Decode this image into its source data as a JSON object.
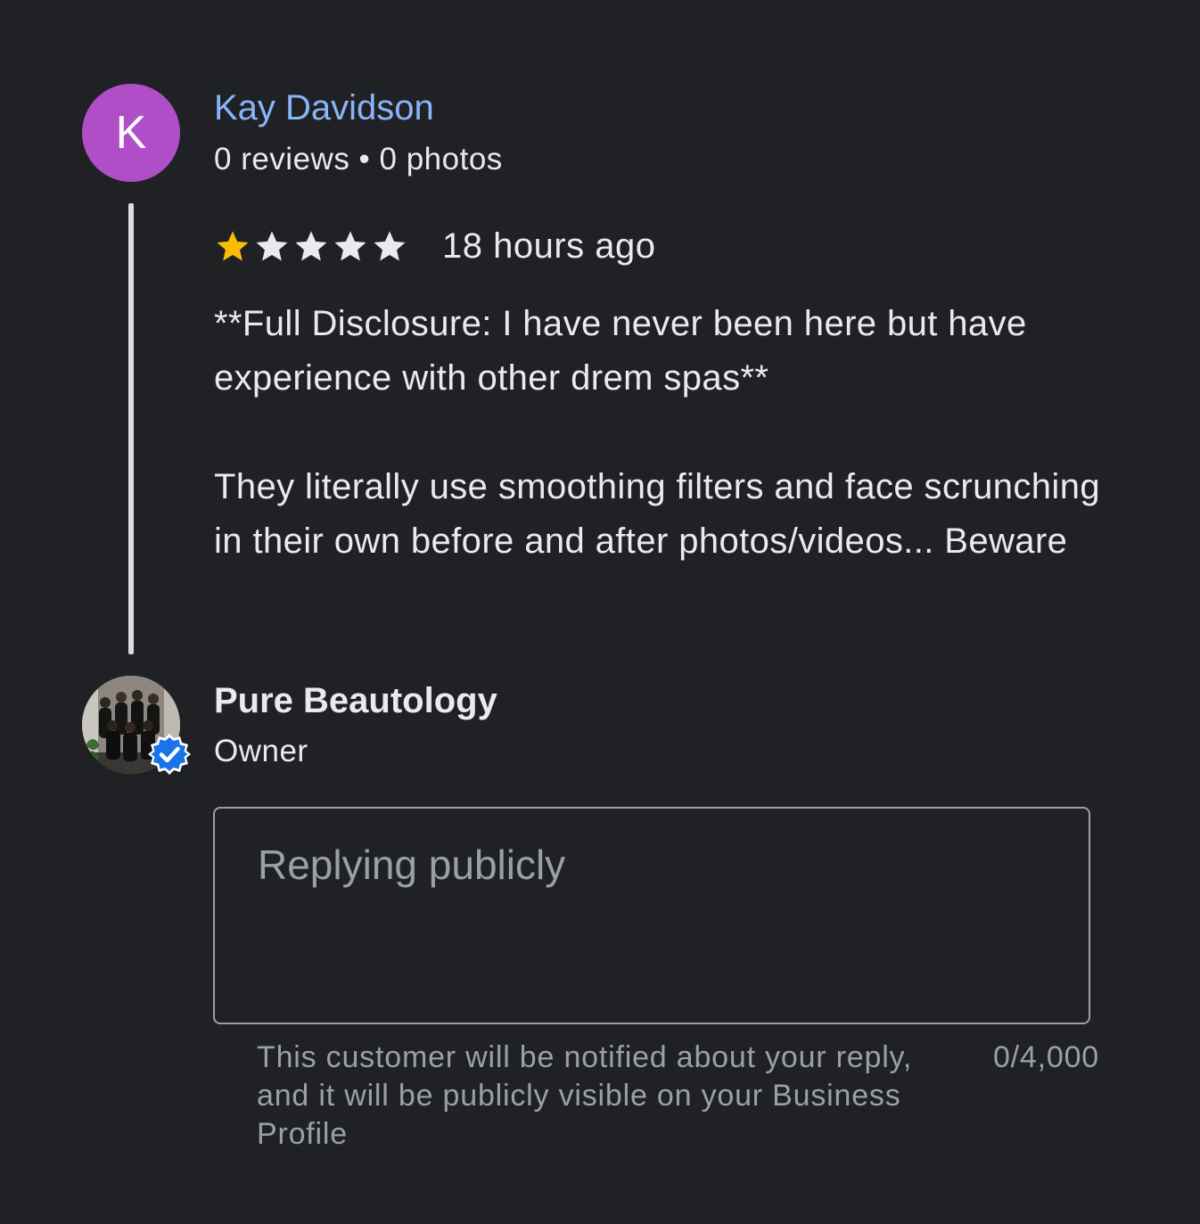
{
  "review": {
    "avatar_initial": "K",
    "avatar_color": "#b04ec8",
    "reviewer_name": "Kay Davidson",
    "reviewer_meta": "0 reviews • 0 photos",
    "rating": 1,
    "rating_max": 5,
    "star_filled_color": "#fbbc04",
    "star_empty_color": "#e8eaed",
    "timestamp": "18 hours ago",
    "text": "**Full Disclosure: I have never been here but have experience with other drem spas**\n\nThey literally use smoothing filters and face scrunching in their own before and after photos/videos... Beware"
  },
  "owner": {
    "name": "Pure Beautology",
    "role": "Owner",
    "avatar_icon": "business-photo",
    "badge_icon": "verified-check-icon",
    "badge_color": "#1a73e8"
  },
  "reply": {
    "placeholder": "Replying publicly",
    "value": "",
    "helper_text": "This customer will be notified about your reply, and it will be publicly visible on your Business Profile",
    "char_counter": "0/4,000"
  }
}
